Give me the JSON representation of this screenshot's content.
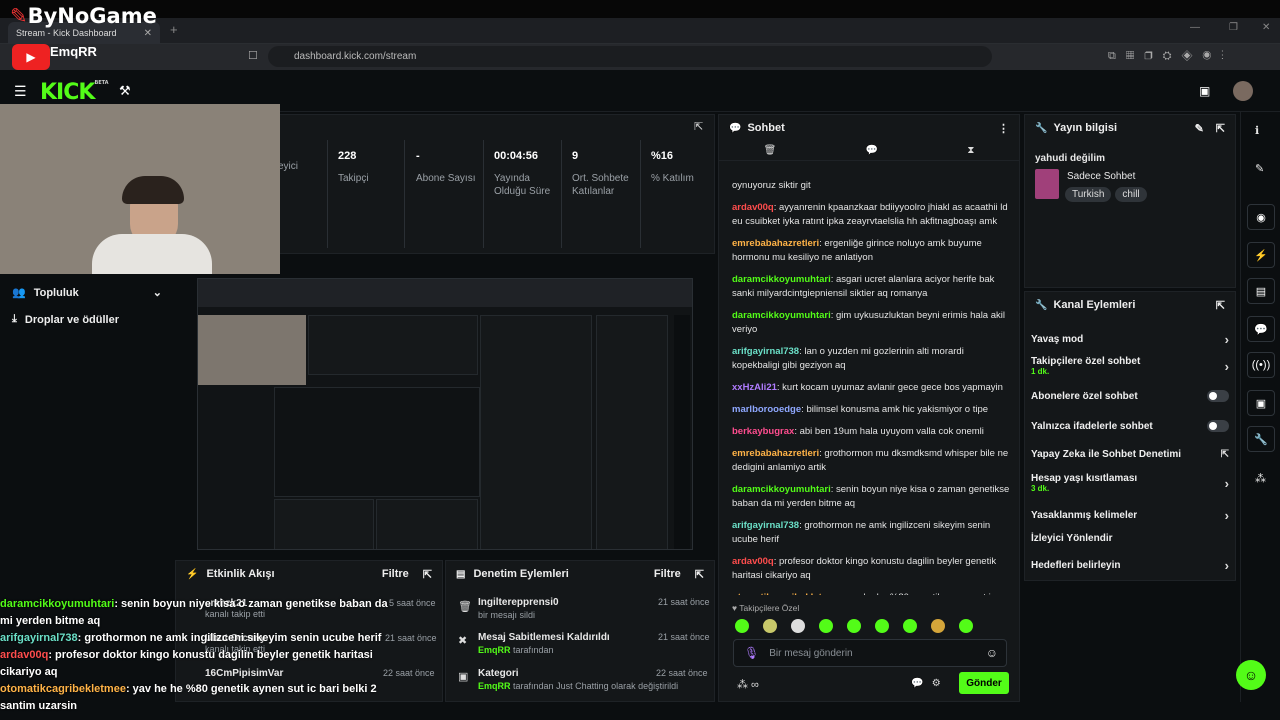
{
  "browser": {
    "tab_title": "Stream - Kick Dashboard",
    "url": "dashboard.kick.com/stream",
    "watermark": "ByNoGame",
    "channel_overlay": "EmqRR"
  },
  "app": {
    "logo": "KICK",
    "logo_badge": "BETA"
  },
  "stats": [
    {
      "value": "",
      "label": "İzleyici"
    },
    {
      "value": "228",
      "label": "Takipçi"
    },
    {
      "value": "-",
      "label": "Abone Sayısı"
    },
    {
      "value": "00:04:56",
      "label": "Yayında Olduğu Süre"
    },
    {
      "value": "9",
      "label": "Ort. Sohbete Katılanlar"
    },
    {
      "value": "%16",
      "label": "% Katılım"
    }
  ],
  "nav": {
    "community": "Topluluk",
    "drops": "Droplar ve ödüller"
  },
  "chat": {
    "title": "Sohbet",
    "messages": [
      {
        "user": "",
        "color": "#e4e4e4",
        "text": "oynuyoruz siktir git"
      },
      {
        "user": "ardav00q",
        "color": "#ff4d4d",
        "text": "ayyanrenin kpaanzkaar bdiiyyoolro jhiakl as acaathii ld eu csuibket iyka ratınt ipka zeayrvtaelslia hh akfitnagboaşı amk"
      },
      {
        "user": "emrebabahazretleri",
        "color": "#ffb347",
        "text": "ergenliğe girince noluyo amk buyume hormonu mu kesiliyo ne anlatiyon"
      },
      {
        "user": "daramcikkoyumuhtari",
        "color": "#53fc18",
        "text": "asgari ucret alanlara aciyor herife bak sanki milyardcintgiepniensil siktier aq romanya"
      },
      {
        "user": "daramcikkoyumuhtari",
        "color": "#53fc18",
        "text": "gim uykusuzluktan beyni erimis hala akil veriyo"
      },
      {
        "user": "arifgayirnal738",
        "color": "#6be0c8",
        "text": "lan o yuzden mi gozlerinin alti morardi kopekbaligi gibi geziyon aq"
      },
      {
        "user": "xxHzAli21",
        "color": "#b07cff",
        "text": "kurt kocam uyumaz avlanir gece gece bos yapmayin"
      },
      {
        "user": "marlboroоedge",
        "color": "#8fa8ff",
        "text": "bilimsel konusma amk hic yakismiyor o tipe"
      },
      {
        "user": "berkaybugrax",
        "color": "#ff4d8f",
        "text": "abi ben 19um hala uyuyom valla cok onemli"
      },
      {
        "user": "emrebabahazretleri",
        "color": "#ffb347",
        "text": "grothormon mu dksmdksmd whisper bile ne dedigini anlamiyo artik"
      },
      {
        "user": "daramcikkoyumuhtari",
        "color": "#53fc18",
        "text": "senin boyun niye kisa o zaman genetikse baban da mi yerden bitme aq"
      },
      {
        "user": "arifgayirnal738",
        "color": "#6be0c8",
        "text": "grothormon ne amk ingilizceni sikeyim senin ucube herif"
      },
      {
        "user": "ardav00q",
        "color": "#ff4d4d",
        "text": "profesor doktor kingo konustu dagilin beyler genetik haritasi cikariyo aq"
      },
      {
        "user": "otomatikcagribekletmee",
        "color": "#ffb347",
        "text": "yav he he %80 genetik aynen sut ic bari belki 2 santim uzarsin"
      }
    ],
    "follower_only": "Takipçilere Özel",
    "placeholder": "Bir mesaj gönderin",
    "send": "Gönder"
  },
  "stream_info": {
    "title": "Yayın bilgisi",
    "stream_title": "yahudi değilim",
    "category": "Sadece Sohbet",
    "tags": [
      "Turkish",
      "chill"
    ]
  },
  "channel_actions": {
    "title": "Kanal Eylemleri",
    "items": [
      {
        "label": "Yavaş mod",
        "sub": "",
        "kind": "chevron"
      },
      {
        "label": "Takipçilere özel sohbet",
        "sub": "1 dk.",
        "kind": "chevron"
      },
      {
        "label": "Abonelere özel sohbet",
        "sub": "",
        "kind": "toggle"
      },
      {
        "label": "Yalnızca ifadelerle sohbet",
        "sub": "",
        "kind": "toggle"
      },
      {
        "label": "Yapay Zeka ile Sohbet Denetimi",
        "sub": "",
        "kind": "external"
      },
      {
        "label": "Hesap yaşı kısıtlaması",
        "sub": "3 dk.",
        "kind": "chevron"
      },
      {
        "label": "Yasaklanmış kelimeler",
        "sub": "",
        "kind": "chevron"
      },
      {
        "label": "İzleyici Yönlendir",
        "sub": "",
        "kind": "none"
      },
      {
        "label": "Hedefleri belirleyin",
        "sub": "",
        "kind": "chevron"
      }
    ]
  },
  "activity": {
    "title": "Etkinlik Akışı",
    "filter": "Filtre",
    "items": [
      {
        "user": "..mhzk21",
        "text": "kanalı takip etti",
        "time": "5 saat önce"
      },
      {
        "user": "Ubut Orcuny",
        "text": "kanalı takip etti",
        "time": "21 saat önce"
      },
      {
        "user": "16CmPipisimVar",
        "text": "",
        "time": "22 saat önce"
      }
    ]
  },
  "moderation": {
    "title": "Denetim Eylemleri",
    "filter": "Filtre",
    "items": [
      {
        "title": "Ingilterepprensi0",
        "desc": "bir mesajı sildi",
        "by": "",
        "time": "21 saat önce"
      },
      {
        "title": "Mesaj Sabitlemesi Kaldırıldı",
        "desc": "tarafından",
        "by": "EmqRR",
        "time": "21 saat önce"
      },
      {
        "title": "Kategori",
        "desc": "tarafından Just Chatting olarak değiştirildi",
        "by": "EmqRR",
        "time": "22 saat önce"
      }
    ]
  },
  "overlay_chat": [
    {
      "user": "daramcikkoyumuhtari",
      "color": "#53fc18",
      "text": ": senin boyun niye kisa o zaman genetikse baban da mi yerden bitme aq"
    },
    {
      "user": "arifgayirnal738",
      "color": "#6be0c8",
      "text": ": grothormon ne amk ingilizceni sikeyim senin ucube herif"
    },
    {
      "user": "ardav00q",
      "color": "#ff4d4d",
      "text": ": profesor doktor kingo konustu dagilin beyler genetik haritasi cikariyo aq"
    },
    {
      "user": "otomatikcagribekletmee",
      "color": "#ffb347",
      "text": ": yav he he %80 genetik aynen sut ic bari belki 2 santim uzarsin"
    }
  ],
  "accent": "#53fc18"
}
